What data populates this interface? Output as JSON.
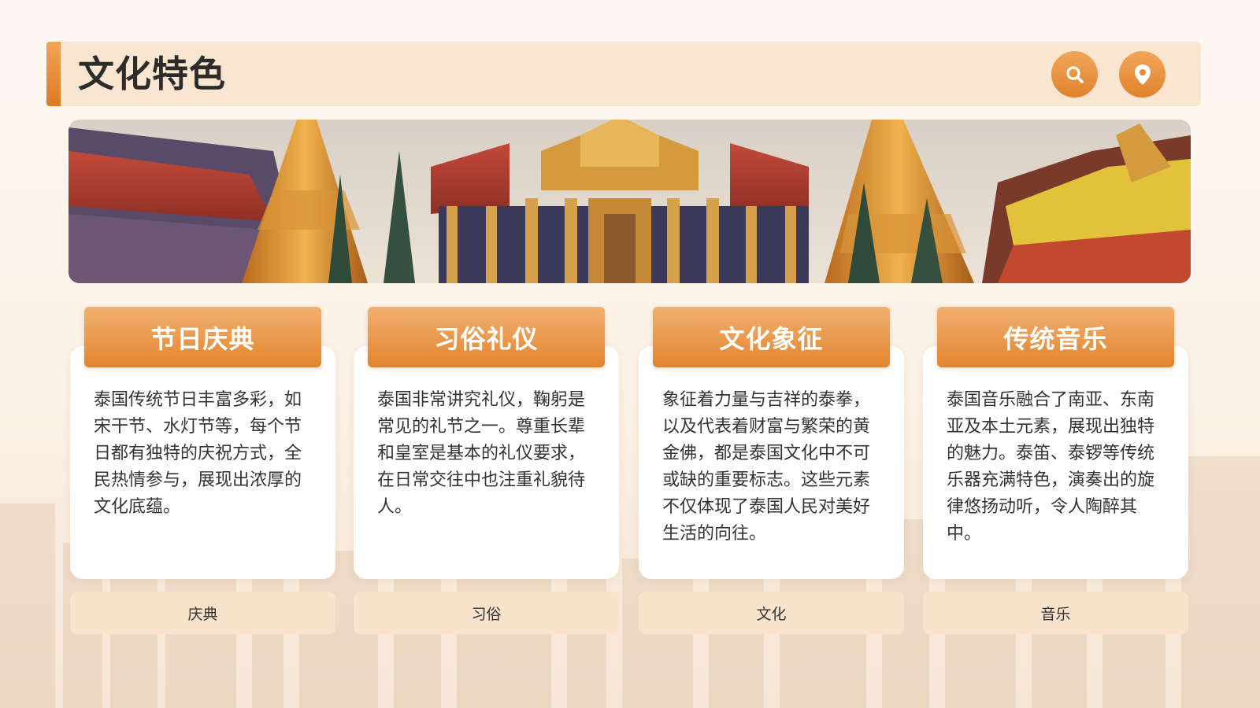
{
  "page": {
    "title": "文化特色",
    "accent_color": "#e2852e",
    "header_bg": "#f9e5d0"
  },
  "header": {
    "icons": [
      "search-icon",
      "location-pin-icon"
    ]
  },
  "cards": [
    {
      "title": "节日庆典",
      "text": "泰国传统节日丰富多彩，如宋干节、水灯节等，每个节日都有独特的庆祝方式，全民热情参与，展现出浓厚的文化底蕴。",
      "tag": "庆典"
    },
    {
      "title": "习俗礼仪",
      "text": "泰国非常讲究礼仪，鞠躬是常见的礼节之一。尊重长辈和皇室是基本的礼仪要求，在日常交往中也注重礼貌待人。",
      "tag": "习俗"
    },
    {
      "title": "文化象征",
      "text": "象征着力量与吉祥的泰拳，以及代表着财富与繁荣的黄金佛，都是泰国文化中不可或缺的重要标志。这些元素不仅体现了泰国人民对美好生活的向往。",
      "tag": "文化"
    },
    {
      "title": "传统音乐",
      "text": "泰国音乐融合了南亚、东南亚及本土元素，展现出独特的魅力。泰笛、泰锣等传统乐器充满特色，演奏出的旋律悠扬动听，令人陶醉其中。",
      "tag": "音乐"
    }
  ]
}
